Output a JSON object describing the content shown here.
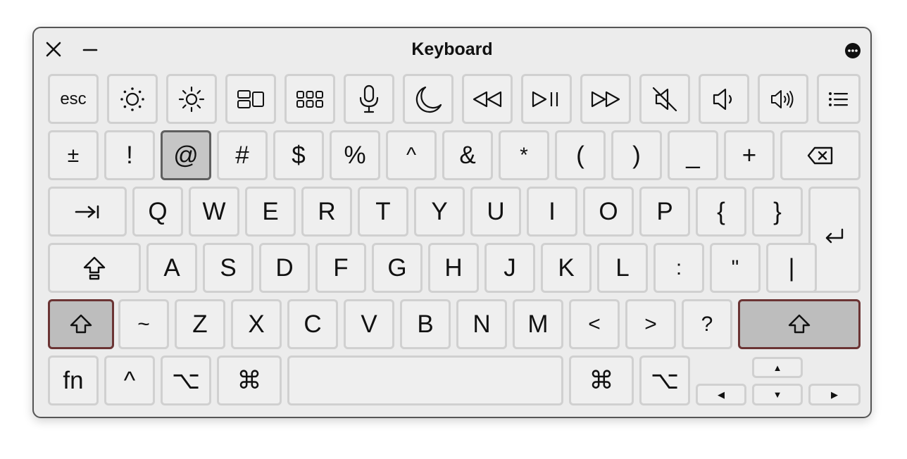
{
  "window": {
    "title": "Keyboard"
  },
  "titlebar": {
    "close_icon": "close-icon",
    "minimize_icon": "minimize-icon",
    "more_icon": "ellipsis-circle-icon"
  },
  "function_row": {
    "esc": "esc",
    "icons": [
      "brightness-down-icon",
      "brightness-up-icon",
      "mission-control-icon",
      "launchpad-icon",
      "dictation-microphone-icon",
      "do-not-disturb-moon-icon",
      "rewind-icon",
      "play-pause-icon",
      "fast-forward-icon",
      "mute-icon",
      "volume-down-icon",
      "volume-up-icon",
      "menu-list-icon"
    ]
  },
  "number_row": [
    "±",
    "!",
    "@",
    "#",
    "$",
    "%",
    "^",
    "&",
    "*",
    "(",
    ")",
    "_",
    "+"
  ],
  "top_row": [
    "Q",
    "W",
    "E",
    "R",
    "T",
    "Y",
    "U",
    "I",
    "O",
    "P",
    "{",
    "}"
  ],
  "home_row": [
    "A",
    "S",
    "D",
    "F",
    "G",
    "H",
    "J",
    "K",
    "L",
    ":",
    "\"",
    "|"
  ],
  "bottom_row": [
    "~",
    "Z",
    "X",
    "C",
    "V",
    "B",
    "N",
    "M",
    "<",
    ">",
    "?"
  ],
  "modifier_row": {
    "fn": "fn",
    "control": "^",
    "option": "⌥",
    "command": "⌘",
    "right_command": "⌘",
    "right_option": "⌥"
  },
  "arrows": {
    "up": "▲",
    "left": "◀",
    "down": "▼",
    "right": "▶"
  },
  "state": {
    "pressed_key": "@",
    "shift_active": true
  },
  "colors": {
    "window_bg": "#ececec",
    "key_bg": "#efefef",
    "key_border": "#d0d0d0",
    "pressed_bg": "#c6c6c6",
    "shift_border": "#6b3434"
  }
}
